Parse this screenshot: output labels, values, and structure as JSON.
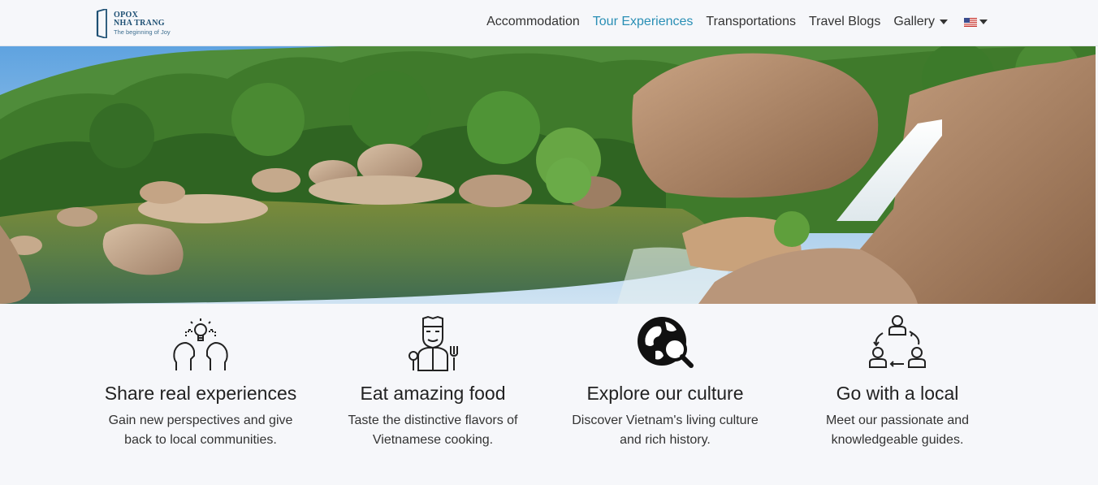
{
  "brand": {
    "line1": "OPOX",
    "line2": "NHA TRANG",
    "tagline": "The beginning of Joy"
  },
  "nav": {
    "items": [
      {
        "label": "Accommodation"
      },
      {
        "label": "Tour Experiences",
        "active": true
      },
      {
        "label": "Transportations"
      },
      {
        "label": "Travel Blogs"
      },
      {
        "label": "Gallery",
        "dropdown": true
      }
    ],
    "language_icon": "us-flag-icon"
  },
  "hero": {
    "image": "waterfall-river-landscape"
  },
  "features": [
    {
      "icon": "idea-sharing-icon",
      "title": "Share real experiences",
      "desc": "Gain new perspectives and give back to local communities."
    },
    {
      "icon": "chef-food-icon",
      "title": "Eat amazing food",
      "desc": "Taste the distinctive flavors of Vietnamese cooking."
    },
    {
      "icon": "globe-search-icon",
      "title": "Explore our culture",
      "desc": "Discover Vietnam's living culture and rich history."
    },
    {
      "icon": "local-people-icon",
      "title": "Go with a local",
      "desc": "Meet our passionate and knowledgeable guides."
    }
  ],
  "colors": {
    "accent": "#2a8fb5",
    "brand": "#1d4f73",
    "background": "#f6f7fa"
  }
}
